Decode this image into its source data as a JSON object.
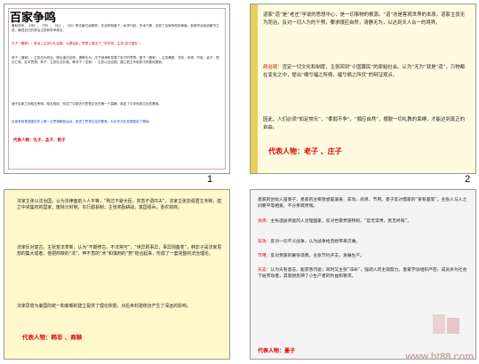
{
  "slides": [
    {
      "number": "1",
      "title": "百家争鸣",
      "para1": "春秋末年，《诗》、《书》、《礼》、《乐》等文献已经散佚，在这种背景下，私学兴起，学术下移，出现了百家争鸣的局面。各家学派纷纷著书立说，阐述自己的政治主张和学术观点。",
      "para_red": "孔子（儒家）：政治上主张以礼治国、以德化民；思想上提出“仁”的学说，主张“克己复礼”。",
      "para2": "老子（道家）：主张无为而治，提出道法自然、清静无为；庄子继承和发展了老子的思想。墨子（墨家）：主张兼爱、非攻、尚贤、节用。孟子：提出仁政、民本思想。荀子：主张礼法并施。韩非子（法家）：主张以法治国，建立君主专制的中央集权国家。",
      "para3": "诸子百家之间相互争辩、相互吸收，形成了中国古代思想文化的第一个高峰，奠定了中华传统文化的基础。",
      "para_blue": "百家争鸣是我国历史上第一次思想解放运动，促进了思想文化的繁荣，为中华文化发展奠定了基础。",
      "footer": "代表人物：孔子、孟子、荀子"
    },
    {
      "number": "2",
      "para1": "道家“道”是“老庄”学说的思想中心，是一切事物的根源。“道”亦是客观世界的本原。道家主张无为而治，反对一切人为的干预，要求顺应自然，清静无为，以达到天人合一的境界。",
      "label_red": "政治观：",
      "para2": "否定一切文化和制度，主张回到“小国寡民”的原始社会。认为“无为”就是“道”，万物都在变化之中，提出“祸兮福之所倚，福兮祸之所伏”的辩证观点。",
      "para3": "因此，人们必须“知足常乐”，“柔弱不争”，“顺应自然”，摆脱一切礼教的束缚，才能达到真正的自由。",
      "footer": "代表人物：老子 、庄子"
    },
    {
      "number": "3",
      "para1": "法家主张以法治国，认为法律面前人人平等，“刑过不避大臣，赏善不遗匹夫”。法家主张加强君主专制，建立中央集权的国家，废除分封制，实行郡县制；主张奖励耕战，富国强兵，重农抑商。",
      "para2": "法家反对复古，主张变法革新，认为“不期修古，不法常可”，“世异则事异，事异则备变”。韩非子是法家思想的集大成者，他把商鞅的“法”、申不害的“术”和慎到的“势”结合起来，形成了一套完整的法治理论。",
      "para3": "法家思想为秦国的统一和秦朝的建立提供了理论依据，对后世封建统治产生了深远的影响。",
      "footer": "代表人物：韩非 、商鞅"
    },
    {
      "number": "4",
      "para1": "墨家的创始人是墨子，墨家的主要思想是兼爱、非攻、尚贤、节用。墨子反对儒家的“爱有差等”，主张人与人之间要平等相爱，不分亲疏贵贱。",
      "label1": "尚贤：",
      "text1": "主张选拔贤能的人治理国家，反对世袭贵族特权，“官无常贵，民无终贱”。",
      "label2": "非攻：",
      "text2": "反对一切不义战争，认为战争给百姓带来灾难。",
      "label3": "节用：",
      "text3": "反对贵族的奢侈浪费，主张节约开支，发展生产。",
      "label4": "天志：",
      "text4": "认为天有意志，能赏善罚恶；同时又主张“非命”，强调人的主观努力。墨家学派组织严密，成员多为社会下层劳动者，其思想反映了小生产者的利益和要求。",
      "footer": "代表人物：墨子"
    }
  ],
  "watermark": "www.ht88.com"
}
